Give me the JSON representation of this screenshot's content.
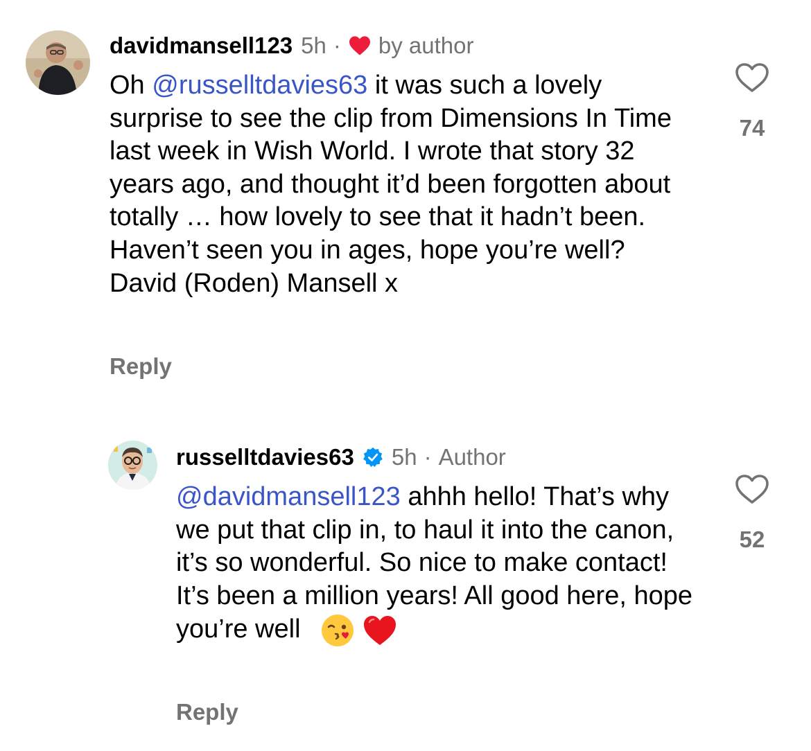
{
  "comments": [
    {
      "username": "davidmansell123",
      "time": "5h",
      "separator": "·",
      "liked_label": "by author",
      "text_prefix": "Oh ",
      "mention": "@russelltdavies63",
      "text": " it was such a lovely surprise to see the clip from Dimensions In Time last week in Wish World. I wrote that story 32 years ago, and thought it’d been forgotten about totally … how lovely to see that it hadn’t been. Haven’t seen you in ages, hope you’re well? David (Roden) Mansell x",
      "reply_label": "Reply",
      "like_count": "74",
      "avatar_icon": "user-avatar-photo"
    },
    {
      "username": "russelltdavies63",
      "time": "5h",
      "separator": "·",
      "author_label": "Author",
      "mention": "@davidmansell123",
      "text": " ahhh hello! That’s why we put that clip in, to haul it into the canon, it’s so wonderful. So nice to make contact! It’s been a million years! All good here, hope you’re well",
      "emojis": [
        "kissing-face-emoji",
        "red-heart-emoji"
      ],
      "reply_label": "Reply",
      "like_count": "52",
      "avatar_icon": "cartoon-avatar",
      "verified_icon": "verified-badge-icon"
    }
  ],
  "colors": {
    "text": "#000000",
    "secondary": "#737373",
    "mention": "#3a55c8",
    "heart": "#ed1c3a",
    "verified": "#0095f6"
  }
}
